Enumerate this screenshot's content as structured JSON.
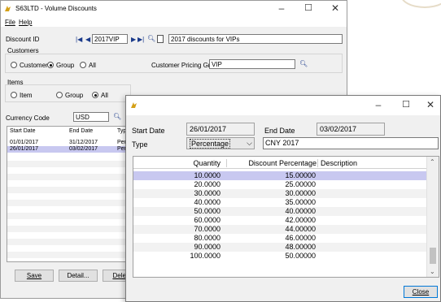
{
  "main": {
    "title": "S63LTD - Volume Discounts",
    "menu": [
      "File",
      "Help"
    ],
    "discount_id_label": "Discount ID",
    "discount_id_value": "2017VIP",
    "discount_desc_value": "2017 discounts for VIPs",
    "customers_label": "Customers",
    "customers_options": [
      "Customer",
      "Group",
      "All"
    ],
    "customers_selected": "Group",
    "customer_pricing_group_label": "Customer Pricing Group",
    "customer_pricing_group_value": "VIP",
    "items_label": "Items",
    "items_options": [
      "Item",
      "Group",
      "All"
    ],
    "items_selected": "All",
    "currency_code_label": "Currency Code",
    "currency_code_value": "USD",
    "grid_headers": [
      "Start Date",
      "End Date",
      "Typ"
    ],
    "grid_rows": [
      {
        "start": "01/01/2017",
        "end": "31/12/2017",
        "type": "Perc"
      },
      {
        "start": "26/01/2017",
        "end": "03/02/2017",
        "type": "Perc"
      }
    ],
    "buttons": {
      "save": "Save",
      "detail": "Detail...",
      "delete": "Delete"
    }
  },
  "detail": {
    "start_date_label": "Start Date",
    "start_date_value": "26/01/2017",
    "end_date_label": "End Date",
    "end_date_value": "03/02/2017",
    "type_label": "Type",
    "type_value": "Percentage",
    "type_desc_value": "CNY 2017",
    "grid_headers": [
      "Quantity",
      "Discount Percentage",
      "Description"
    ],
    "grid_rows": [
      {
        "quantity": "10.0000",
        "discount": "15.00000",
        "description": ""
      },
      {
        "quantity": "20.0000",
        "discount": "25.00000",
        "description": ""
      },
      {
        "quantity": "30.0000",
        "discount": "30.00000",
        "description": ""
      },
      {
        "quantity": "40.0000",
        "discount": "35.00000",
        "description": ""
      },
      {
        "quantity": "50.0000",
        "discount": "40.00000",
        "description": ""
      },
      {
        "quantity": "60.0000",
        "discount": "42.00000",
        "description": ""
      },
      {
        "quantity": "70.0000",
        "discount": "44.00000",
        "description": ""
      },
      {
        "quantity": "80.0000",
        "discount": "46.00000",
        "description": ""
      },
      {
        "quantity": "90.0000",
        "discount": "48.00000",
        "description": ""
      },
      {
        "quantity": "100.0000",
        "discount": "50.00000",
        "description": ""
      }
    ],
    "close_label": "Close"
  },
  "colors": {
    "selection": "#c8c8f0",
    "app_icon": "#d4a017"
  },
  "icons": [
    "app-icon",
    "search-icon",
    "first-record-icon",
    "prev-record-icon",
    "next-record-icon",
    "last-record-icon",
    "new-record-icon",
    "scroll-up-icon",
    "scroll-down-icon",
    "dropdown-icon",
    "minimize-icon",
    "maximize-icon",
    "close-icon"
  ]
}
